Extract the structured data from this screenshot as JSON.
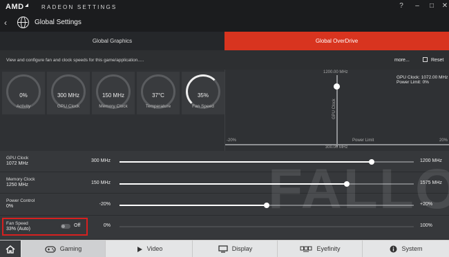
{
  "window": {
    "brand": "AMD",
    "title": "RADEON SETTINGS"
  },
  "header": {
    "title": "Global Settings"
  },
  "tabs": [
    {
      "label": "Global Graphics",
      "active": false
    },
    {
      "label": "Global OverDrive",
      "active": true
    }
  ],
  "description": "View and configure fan and clock speeds for this game/application.....",
  "actions": {
    "more": "more...",
    "reset": "Reset"
  },
  "gauges": [
    {
      "value": "0%",
      "label": "Activity"
    },
    {
      "value": "300 MHz",
      "label": "GPU Clock"
    },
    {
      "value": "150 MHz",
      "label": "Memory Clock"
    },
    {
      "value": "37°C",
      "label": "Temperature"
    },
    {
      "value": "35%",
      "label": "Fan Speed"
    }
  ],
  "graph": {
    "top": "1200.00 MHz",
    "bottom": "300.00 MHz",
    "xmin": "-20%",
    "xmax": "20%",
    "xlabel": "Power Limit",
    "ylabel": "GPU Clock",
    "info1": "GPU Clock: 1072.00 MHz",
    "info2": "Power Limit: 0%"
  },
  "sliders": [
    {
      "name": "GPU Clock",
      "value": "1072 MHz",
      "min": "300 MHz",
      "max": "1200 MHz",
      "fraction": 0.856
    },
    {
      "name": "Memory Clock",
      "value": "1250 MHz",
      "min": "150 MHz",
      "max": "1575 MHz",
      "fraction": 0.772
    },
    {
      "name": "Power Control",
      "value": "0%",
      "min": "-20%",
      "max": "+20%",
      "fraction": 0.5
    },
    {
      "name": "Fan Speed",
      "value": "33% (Auto)",
      "min": "0%",
      "max": "100%",
      "toggle": "Off",
      "fraction": 0
    }
  ],
  "watermark": "FALLO",
  "nav": [
    {
      "label": "Gaming",
      "icon": "gamepad-icon"
    },
    {
      "label": "Video",
      "icon": "play-icon"
    },
    {
      "label": "Display",
      "icon": "monitor-icon"
    },
    {
      "label": "Eyefinity",
      "icon": "eyefinity-icon"
    },
    {
      "label": "System",
      "icon": "info-icon"
    }
  ]
}
